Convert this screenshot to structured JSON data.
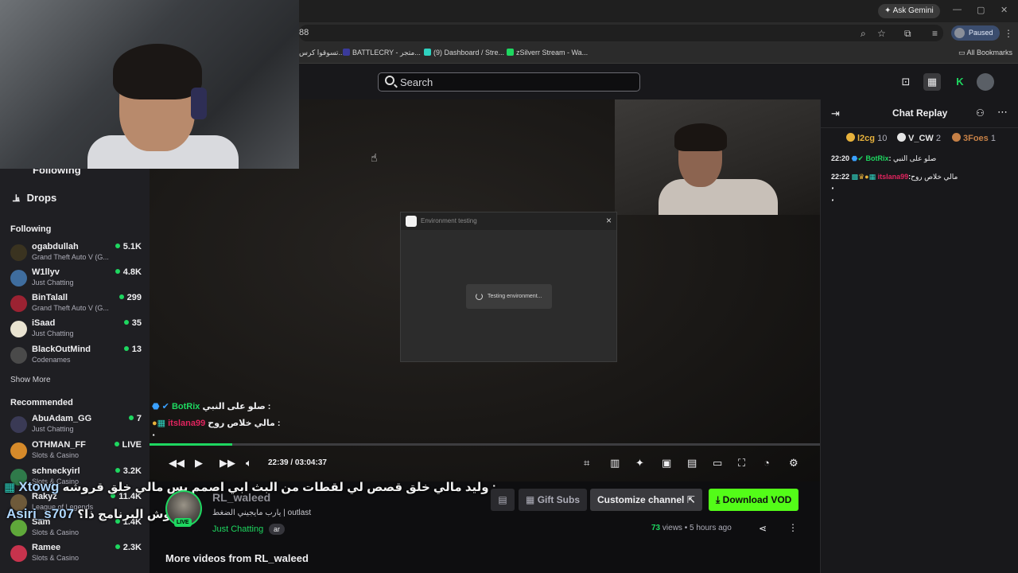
{
  "browser": {
    "url_fragment": "88",
    "gemini_label": "Ask Gemini",
    "profile_label": "Paused",
    "bookmarks": [
      "تسوقوا كرس...",
      "BATTLECRY - متجر...",
      "(9) Dashboard / Stre...",
      "zSilverr Stream - Wa..."
    ],
    "all_bookmarks": "All Bookmarks"
  },
  "header": {
    "search_placeholder": "Search"
  },
  "sidebar": {
    "nav": [
      {
        "label": "Following"
      },
      {
        "label": "Drops"
      }
    ],
    "following_title": "Following",
    "following": [
      {
        "name": "ogabdullah",
        "game": "Grand Theft Auto V (G...",
        "viewers": "5.1K",
        "color": "#3a3320"
      },
      {
        "name": "W1llyv",
        "game": "Just Chatting",
        "viewers": "4.8K",
        "color": "#3f6d9e"
      },
      {
        "name": "BinTalall",
        "game": "Grand Theft Auto V (G...",
        "viewers": "299",
        "color": "#9b2232"
      },
      {
        "name": "iSaad",
        "game": "Just Chatting",
        "viewers": "35",
        "color": "#e9e3d1"
      },
      {
        "name": "BlackOutMind",
        "game": "Codenames",
        "viewers": "13",
        "color": "#4a4a4a"
      }
    ],
    "show_more": "Show More",
    "recommended_title": "Recommended",
    "recommended": [
      {
        "name": "AbuAdam_GG",
        "game": "Just Chatting",
        "viewers": "7",
        "color": "#3a3a55"
      },
      {
        "name": "OTHMAN_FF",
        "game": "Slots & Casino",
        "viewers": "LIVE",
        "color": "#d68a2a"
      },
      {
        "name": "schneckyirl",
        "game": "Slots & Casino",
        "viewers": "3.2K",
        "color": "#2f7a4a"
      },
      {
        "name": "Rakyz",
        "game": "League of Legends",
        "viewers": "11.4K",
        "color": "#6e5a3a"
      },
      {
        "name": "Sam",
        "game": "Slots & Casino",
        "viewers": "1.4K",
        "color": "#5fa83a"
      },
      {
        "name": "Ramee",
        "game": "Slots & Casino",
        "viewers": "2.3K",
        "color": "#c7334d"
      }
    ]
  },
  "dialog": {
    "title": "Environment testing",
    "close": "×",
    "message": "Testing environment..."
  },
  "player": {
    "overlay_chat": [
      {
        "user": "BotRix",
        "text": "صلو على النبي :",
        "color": "#1ed760"
      },
      {
        "user": "itslana99",
        "text": "مالي خلاص روح :",
        "color": "#e0245e"
      }
    ],
    "overlay_spam": "ٔٔٔٔٔٔٔٔٔٔٔٔٔٔٔٔٔٔٔٔٔٔٔٔٔٔٔٔٔٔٔٔٔٔٔٔٔٔٔٔٔٔٔٔٔٔٔٔٔٔ",
    "progress": 0.123,
    "current_time": "22:39",
    "time_separator": "/",
    "duration": "03:04:37"
  },
  "captions": [
    {
      "nick": "Xtowg",
      "text": "وليد مالي خلق قصص لي لقطات من البث ابي اصمم بس مالي خلق قروشه :"
    },
    {
      "nick": "Asiri_s707",
      "text": "وش البرنامج ذا؟ :"
    }
  ],
  "channel": {
    "live_badge": "LIVE",
    "name": "RL_waleed",
    "subtitle_ar": "يارب مايجيني الضغط",
    "subtitle_sep": "|",
    "subtitle_en": "outlast",
    "category": "Just Chatting",
    "tag": "ar",
    "gift_subs": "Gift Subs",
    "customize": "Customize channel",
    "download": "Download VOD",
    "views_count": "73",
    "views_word": "views",
    "age": "5 hours ago"
  },
  "more_videos": "More videos from RL_waleed",
  "chat": {
    "title": "Chat Replay",
    "leaders": [
      {
        "name": "l2cg",
        "count": "10",
        "color": "#e8b23c"
      },
      {
        "name": "V_CW",
        "count": "2",
        "color": "#e6e6e6"
      },
      {
        "name": "3Foes",
        "count": "1",
        "color": "#c68046"
      }
    ],
    "messages": [
      {
        "time": "22:20",
        "user": "BotRix",
        "user_color": "#1ed760",
        "text": "صلو على النبي"
      },
      {
        "time": "22:22",
        "user": "itslana99",
        "user_color": "#e0245e",
        "text": "مالي خلاص روح"
      }
    ],
    "spam1": "ٔٔٔٔٔٔٔٔٔٔٔٔٔٔٔٔٔٔٔٔٔٔٔٔٔٔٔٔٔٔٔٔٔٔٔٔٔٔٔٔٔٔٔٔٔٔٔ",
    "spam2": "ٔٔٔٔٔٔٔٔٔٔٔٔٔٔٔٔٔٔٔٔٔ"
  }
}
